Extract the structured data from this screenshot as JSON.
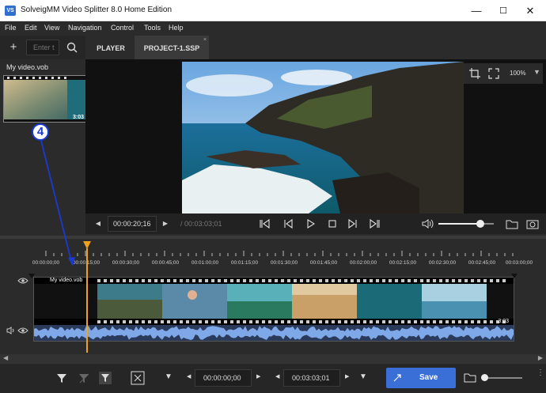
{
  "window": {
    "title": "SolveigMM Video Splitter 8.0 Home Edition",
    "icon_text": "VS",
    "minimize_glyph": "—",
    "maximize_glyph": "☐",
    "close_glyph": "✕"
  },
  "menu": [
    "File",
    "Edit",
    "View",
    "Navigation",
    "Control",
    "Tools",
    "Help"
  ],
  "left_panel": {
    "search_placeholder": "Enter t",
    "add_glyph": "+",
    "media_title": "My video.vob",
    "thumb_duration": "3:03"
  },
  "annotation": {
    "step_number": "4"
  },
  "tabs": [
    {
      "label": "PLAYER",
      "active": false
    },
    {
      "label": "PROJECT-1.SSP",
      "active": true
    }
  ],
  "player": {
    "zoom": "100%",
    "current_time": "00:00:20;16",
    "total_time": "/ 00:03:03;01",
    "volume_level": 0.75
  },
  "timeline": {
    "ruler_labels": [
      "00:00:00;00",
      "00:00:15;00",
      "00:00:30;00",
      "00:00:45;00",
      "00:01:00;00",
      "00:01:15;00",
      "00:01:30;00",
      "00:01:45;00",
      "00:02:00;00",
      "00:02:15;00",
      "00:02:30;00",
      "00:02:45;00",
      "00:03:00;00"
    ],
    "clip_title": "My video.vob",
    "clip_duration": "3:03"
  },
  "bottom": {
    "start_time": "00:00:00;00",
    "end_time": "00:03:03;01",
    "save_label": "Save"
  },
  "colors": {
    "accent": "#3a6fd8",
    "playhead": "#f0a020",
    "annotation_arrow": "#1a3ad0",
    "waveform": "#7fa8e8"
  }
}
